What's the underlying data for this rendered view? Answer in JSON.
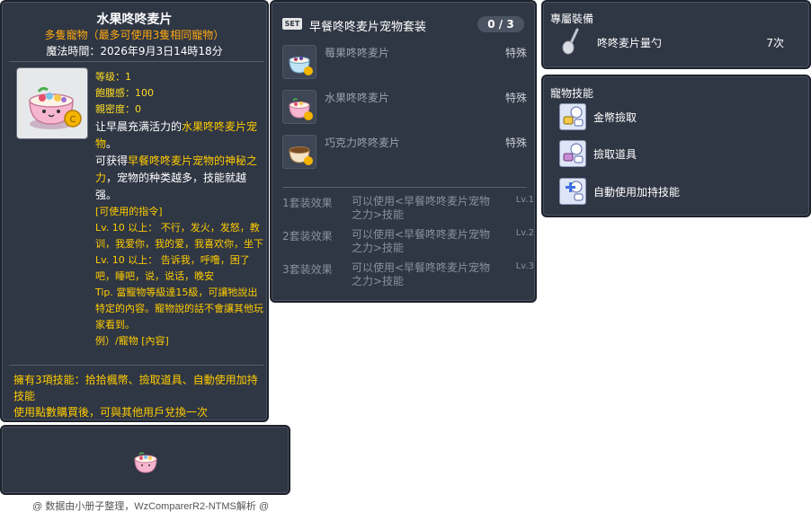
{
  "item_id": "05002780",
  "pet": {
    "title": "水果咚咚麦片",
    "subtitle": "多隻寵物（最多可使用3隻相同寵物）",
    "magic_time": "魔法時間：2026年9月3日14時18分",
    "stats": {
      "level": "等级：1",
      "hunger": "飽腹感：100",
      "intimacy": "親密度：0"
    },
    "desc": {
      "p1_pre": "让早晨充满活力的",
      "p1_hl": "水果咚咚麦片宠物",
      "p1_post": "。",
      "p2_pre": "可获得",
      "p2_hl": "早餐咚咚麦片宠物的神秘之力",
      "p2_post": "，宠物的种类越多，技能就越强。",
      "commands_header": "[可使用的指令]",
      "cmd1": "Lv. 10 以上： 不行，发火，发怒，教训，我爱你，我的爱，我喜欢你，坐下",
      "cmd2": "Lv. 10 以上： 告诉我，呼噜，困了吧，睡吧，说，说话，晚安",
      "tip": "Tip. 當寵物等級達15級，可讓牠說出特定的內容。寵物說的話不會讓其他玩家看到。",
      "example": "例）/寵物 [內容]"
    },
    "skill_info": "擁有3項技能：拾拾楓幣、撿取道具、自動使用加持技能",
    "transfer_info": "使用點數購買後，可與其他用戶兌換一次"
  },
  "set": {
    "badge": "SET",
    "title": "早餐咚咚麦片宠物套装",
    "count": "0 / 3",
    "items": [
      {
        "name": "莓果咚咚麦片",
        "type": "特殊"
      },
      {
        "name": "水果咚咚麦片",
        "type": "特殊"
      },
      {
        "name": "巧克力咚咚麦片",
        "type": "特殊"
      }
    ],
    "effects": [
      {
        "label": "1套装效果",
        "text": "可以使用<早餐咚咚麦片宠物之力>技能",
        "lv": "Lv.1"
      },
      {
        "label": "2套装效果",
        "text": "可以使用<早餐咚咚麦片宠物之力>技能",
        "lv": "Lv.2"
      },
      {
        "label": "3套装效果",
        "text": "可以使用<早餐咚咚麦片宠物之力>技能",
        "lv": "Lv.3"
      }
    ]
  },
  "equip": {
    "title": "專屬裝備",
    "name": "咚咚麦片量勺",
    "count": "7次"
  },
  "skills": {
    "title": "寵物技能",
    "items": [
      "金幣撿取",
      "撿取道具",
      "自動使用加持技能"
    ]
  },
  "footer": "@ 数据由小册子整理，WzComparerR2-NTMS解析 @",
  "colors": {
    "panel_bg": "#2f3644",
    "highlight": "#ffcc00",
    "subtitle": "#ffaa11",
    "muted": "#8a919c"
  }
}
